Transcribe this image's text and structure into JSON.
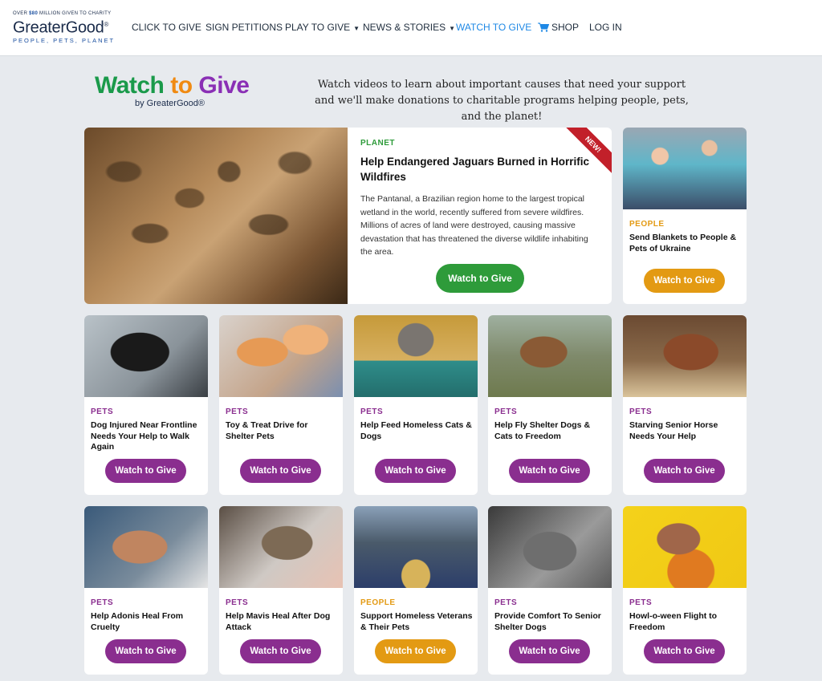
{
  "header": {
    "logo_tag_pre": "OVER ",
    "logo_tag_num": "$80",
    "logo_tag_post": " MILLION GIVEN TO CHARITY",
    "logo_name": "GreaterGood",
    "logo_reg": "®",
    "logo_sub": "PEOPLE, PETS, PLANET",
    "nav": {
      "click_to_give": "CLICK TO GIVE",
      "sign_petitions": "SIGN PETITIONS",
      "play_to_give": "PLAY TO GIVE",
      "news_stories": "NEWS & STORIES",
      "watch_to_give": "WATCH TO GIVE",
      "shop": "SHOP",
      "log_in": "LOG IN"
    },
    "active_color": "#1e88e5"
  },
  "hero": {
    "title_watch": "Watch",
    "title_to": "to",
    "title_give": "Give",
    "by": "by GreaterGood®",
    "description": "Watch videos to learn about important causes that need your support and we'll make donations to charitable programs helping people, pets, and the planet!"
  },
  "featured": {
    "category": "PLANET",
    "badge": "NEW!",
    "title": "Help Endangered Jaguars Burned in Horrific Wildfires",
    "text": "The Pantanal, a Brazilian region home to the largest tropical wetland in the world, recently suffered from severe wildfires. Millions of acres of land were destroyed, causing massive devastation that has threatened the diverse wildlife inhabiting the area.",
    "button": "Watch to Give"
  },
  "side_card": {
    "category": "PEOPLE",
    "title": "Send Blankets to People & Pets of Ukraine",
    "button": "Watch to Give"
  },
  "row1": [
    {
      "category": "PETS",
      "title": "Dog Injured Near Frontline Needs Your Help to Walk Again",
      "button": "Watch to Give"
    },
    {
      "category": "PETS",
      "title": "Toy & Treat Drive for Shelter Pets",
      "button": "Watch to Give"
    },
    {
      "category": "PETS",
      "title": "Help Feed Homeless Cats & Dogs",
      "button": "Watch to Give"
    },
    {
      "category": "PETS",
      "title": "Help Fly Shelter Dogs & Cats to Freedom",
      "button": "Watch to Give"
    },
    {
      "category": "PETS",
      "title": "Starving Senior Horse Needs Your Help",
      "button": "Watch to Give"
    }
  ],
  "row2": [
    {
      "category": "PETS",
      "title": "Help Adonis Heal From Cruelty",
      "button": "Watch to Give"
    },
    {
      "category": "PETS",
      "title": "Help Mavis Heal After Dog Attack",
      "button": "Watch to Give"
    },
    {
      "category": "PEOPLE",
      "title": "Support Homeless Veterans & Their Pets",
      "button": "Watch to Give"
    },
    {
      "category": "PETS",
      "title": "Provide Comfort To Senior Shelter Dogs",
      "button": "Watch to Give"
    },
    {
      "category": "PETS",
      "title": "Howl-o-ween Flight to Freedom",
      "button": "Watch to Give"
    }
  ],
  "colors": {
    "planet": "#2e9b3a",
    "pets": "#8a2e8f",
    "people": "#e39a13",
    "badge": "#c2202a"
  }
}
